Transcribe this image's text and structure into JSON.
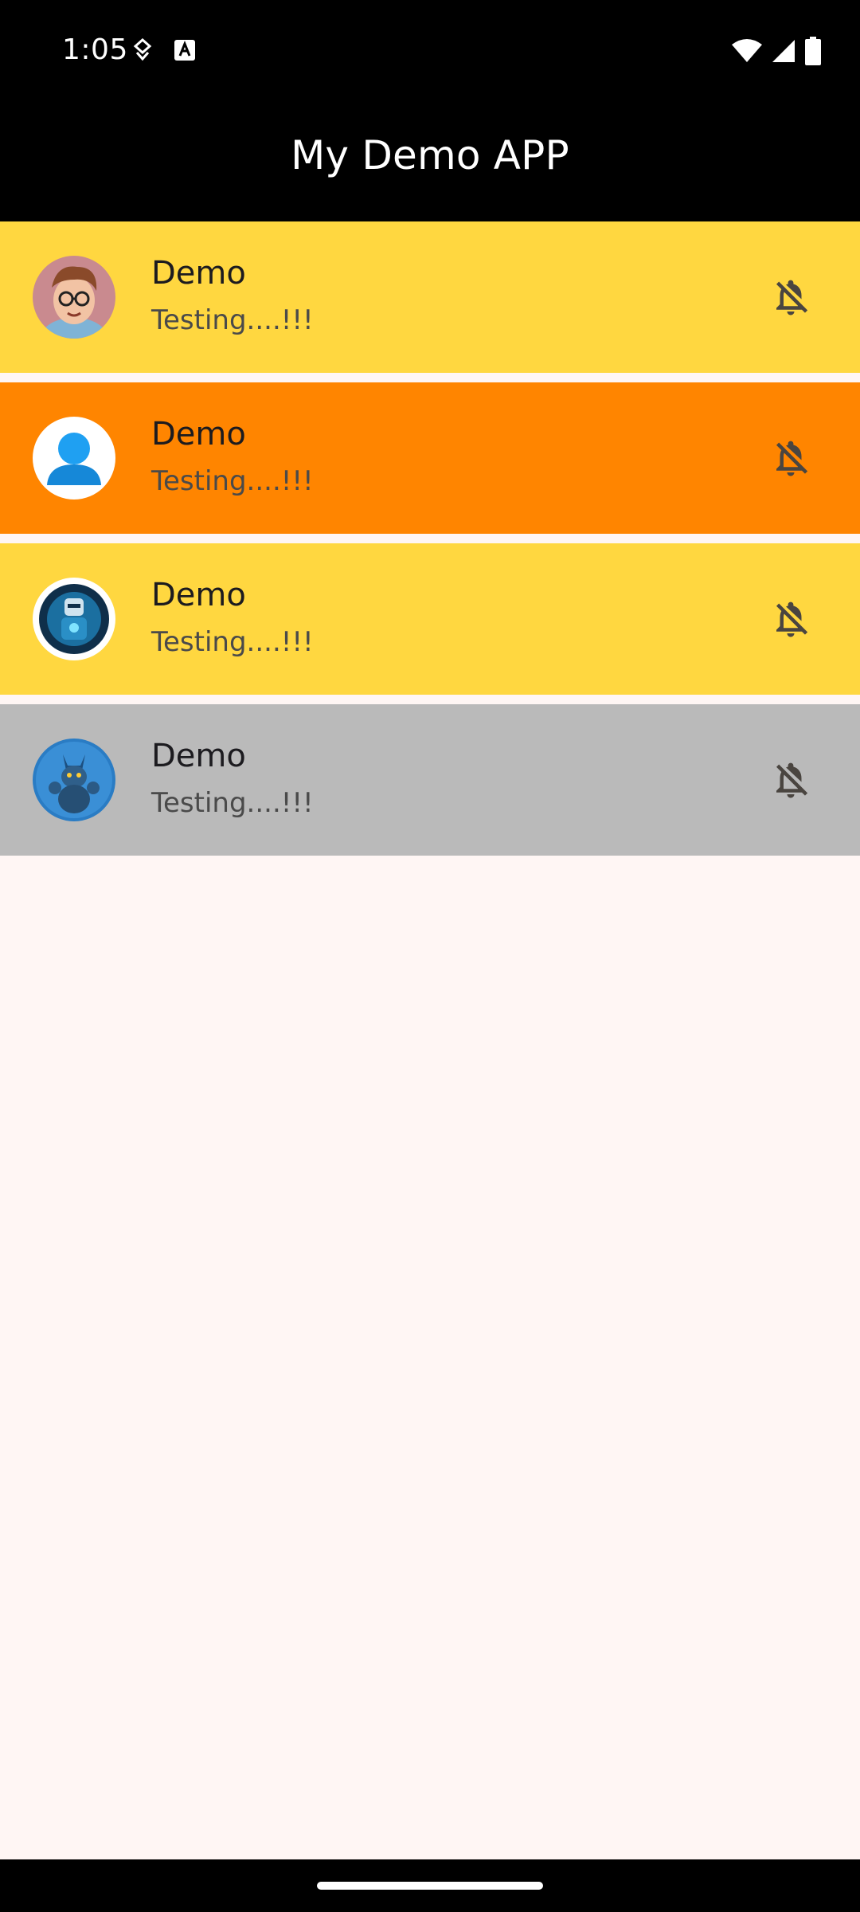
{
  "status_bar": {
    "time": "1:05",
    "left_icons": [
      "data-saver-icon",
      "keyboard-a-icon"
    ],
    "right_icons": [
      "wifi-icon",
      "cell-signal-icon",
      "battery-icon"
    ]
  },
  "app_bar": {
    "title": "My Demo APP"
  },
  "colors": {
    "yellow": "#ffd740",
    "orange": "#ff8500",
    "grey": "#bababa",
    "background": "#fff6f4",
    "bar": "#000000"
  },
  "list": {
    "items": [
      {
        "title": "Demo",
        "subtitle": "Testing....!!!",
        "avatar": "cartoon-boy-avatar",
        "color": "#ffd740",
        "icon": "notifications-off-icon"
      },
      {
        "title": "Demo",
        "subtitle": "Testing....!!!",
        "avatar": "blue-person-avatar",
        "color": "#ff8500",
        "icon": "notifications-off-icon"
      },
      {
        "title": "Demo",
        "subtitle": "Testing....!!!",
        "avatar": "robot-avatar",
        "color": "#ffd740",
        "icon": "notifications-off-icon"
      },
      {
        "title": "Demo",
        "subtitle": "Testing....!!!",
        "avatar": "creature-avatar",
        "color": "#bababa",
        "icon": "notifications-off-icon"
      }
    ]
  }
}
